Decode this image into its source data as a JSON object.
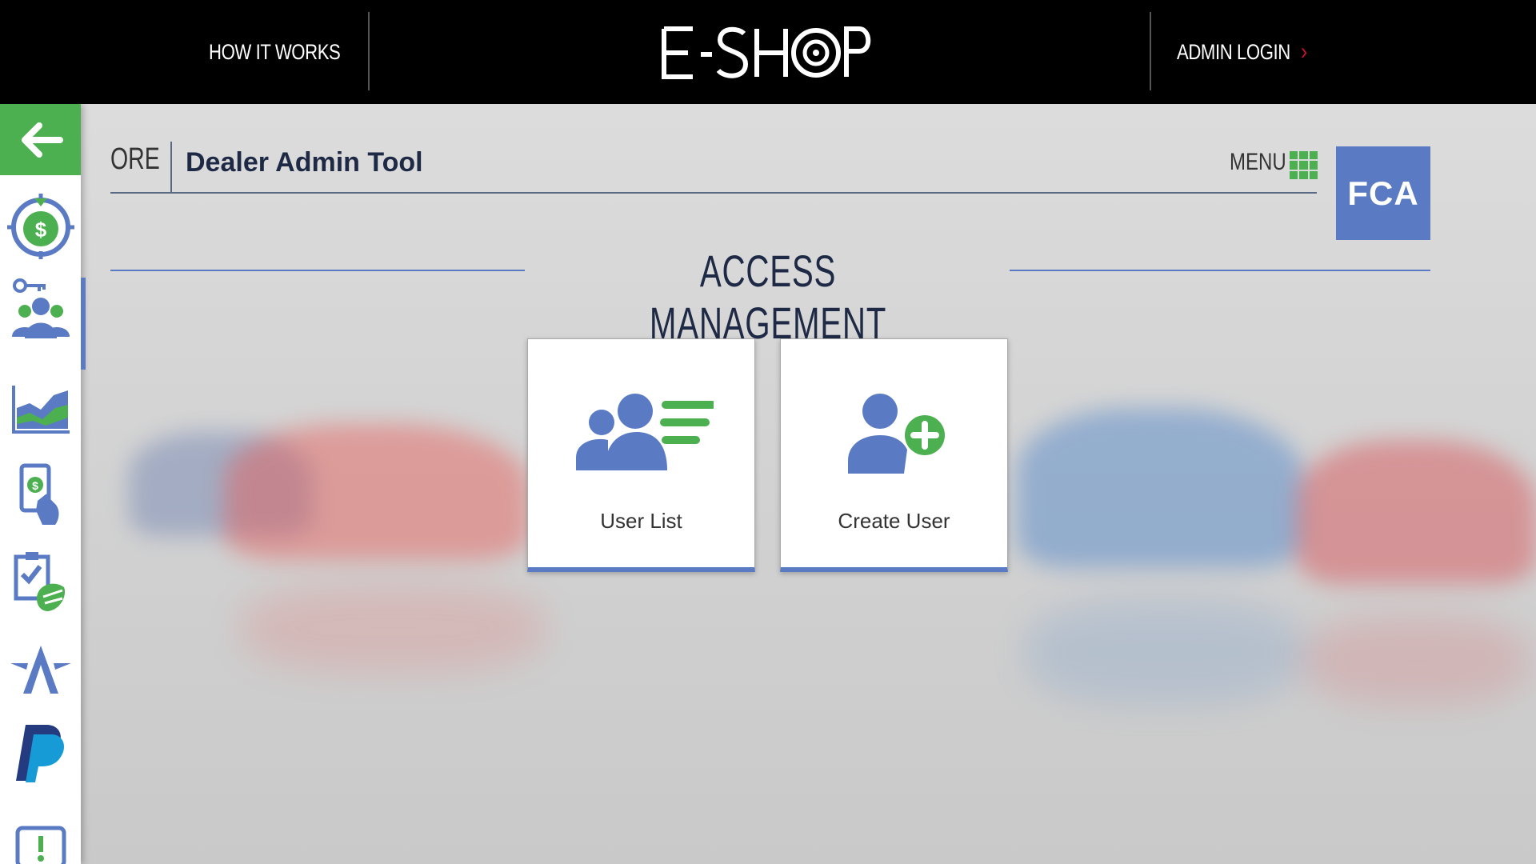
{
  "topbar": {
    "how_it_works": "HOW IT WORKS",
    "logo_text": "E-SHOP",
    "admin_login": "ADMIN LOGIN"
  },
  "header": {
    "ore": "ORE",
    "title": "Dealer Admin Tool",
    "menu_label": "MENU",
    "brand_logo": "FCA"
  },
  "section": {
    "title": "ACCESS MANAGEMENT"
  },
  "cards": [
    {
      "label": "User List",
      "icon": "user-list-icon"
    },
    {
      "label": "Create User",
      "icon": "add-user-icon"
    }
  ],
  "sidebar": {
    "items": [
      {
        "icon": "back-arrow-icon"
      },
      {
        "icon": "money-target-icon"
      },
      {
        "icon": "access-management-icon"
      },
      {
        "icon": "chart-icon"
      },
      {
        "icon": "mobile-payment-icon"
      },
      {
        "icon": "checklist-icon"
      },
      {
        "icon": "star-logo-icon"
      },
      {
        "icon": "paypal-icon"
      },
      {
        "icon": "alert-icon"
      }
    ]
  },
  "colors": {
    "accent_green": "#4caf50",
    "accent_blue": "#5a7bc4",
    "dark_navy": "#1e2a45",
    "topbar_bg": "#000000",
    "chevron_red": "#c8102e"
  }
}
